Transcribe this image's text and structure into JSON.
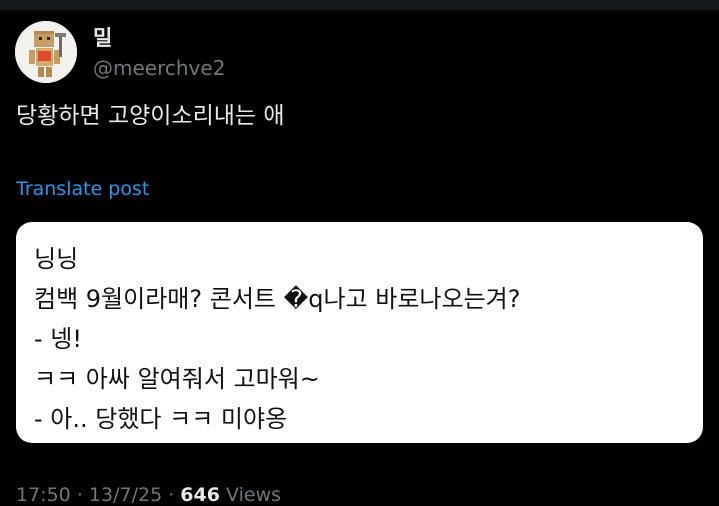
{
  "author": {
    "display_name": "밀",
    "handle": "@meerchve2",
    "avatar_icon": "cardboard-robot-avatar-icon"
  },
  "post": {
    "text": "당황하면 고양이소리내는 애",
    "translate_label": "Translate post"
  },
  "media": {
    "lines": [
      "닝닝",
      "컴백 9월이라매? 콘서트 �q나고 바로나오는겨?",
      "- 넹!",
      "ㅋㅋ 아싸 알여줘서 고마워~",
      "- 아.. 당했다 ㅋㅋ 미야옹"
    ]
  },
  "meta": {
    "time": "17:50",
    "separator": "·",
    "date": "13/7/25",
    "views_count": "646",
    "views_label": "Views"
  },
  "colors": {
    "background": "#000000",
    "text_primary": "#e7e9ea",
    "text_secondary": "#71767b",
    "link": "#1d9bf0",
    "card_background": "#ffffff"
  }
}
